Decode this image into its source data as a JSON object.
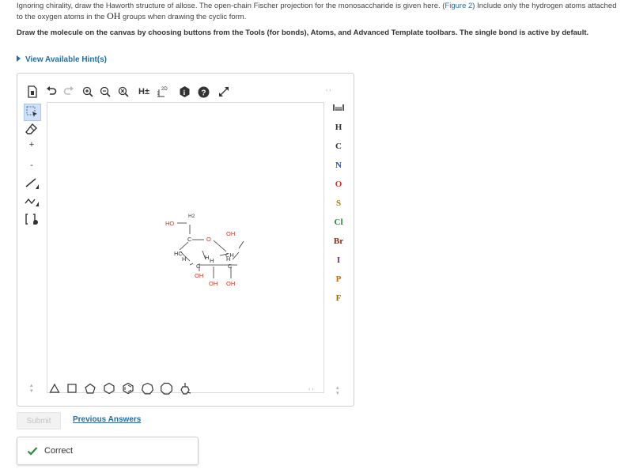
{
  "instructions": {
    "part1": "Ignoring chirality, draw the Haworth structure of allose. The open-chain Fischer projection for the monosaccharide is given here. (",
    "figure_link": "Figure 2",
    "part2": ") Include only the hydrogen atoms attached to the oxygen atoms in the ",
    "oh": "OH",
    "part3": " groups when drawing the cyclic form."
  },
  "task": "Draw the molecule on the canvas by choosing buttons from the Tools (for bonds), Atoms, and Advanced Template toolbars. The single bond is active by default.",
  "hint_label": "View Available Hint(s)",
  "toolbar": {
    "h_label": "H±",
    "twod_label": "2D",
    "help_label": "?"
  },
  "left_tools": {
    "plus": "+",
    "minus": "-"
  },
  "atoms": [
    "H",
    "C",
    "N",
    "O",
    "S",
    "Cl",
    "Br",
    "I",
    "P",
    "F"
  ],
  "atom_colors": {
    "H": "#333333",
    "C": "#333333",
    "N": "#2c4fb3",
    "O": "#d6301a",
    "S": "#9a7a00",
    "Cl": "#1e8a2e",
    "Br": "#8b2a12",
    "I": "#6a2a9a",
    "P": "#cc6a00",
    "F": "#9a6a00"
  },
  "molecule": {
    "labels": [
      "HO",
      "H2",
      "C",
      "O",
      "OH",
      "CH",
      "HC",
      "H",
      "H",
      "C",
      "C",
      "OH",
      "OH",
      "OH",
      "H",
      "H"
    ]
  },
  "submit_label": "Submit",
  "previous_answers_label": "Previous Answers",
  "result_label": "Correct",
  "colors": {
    "link": "#1a6fa8",
    "correct_green": "#2e8b3a",
    "oxygen_red": "#d6301a"
  }
}
